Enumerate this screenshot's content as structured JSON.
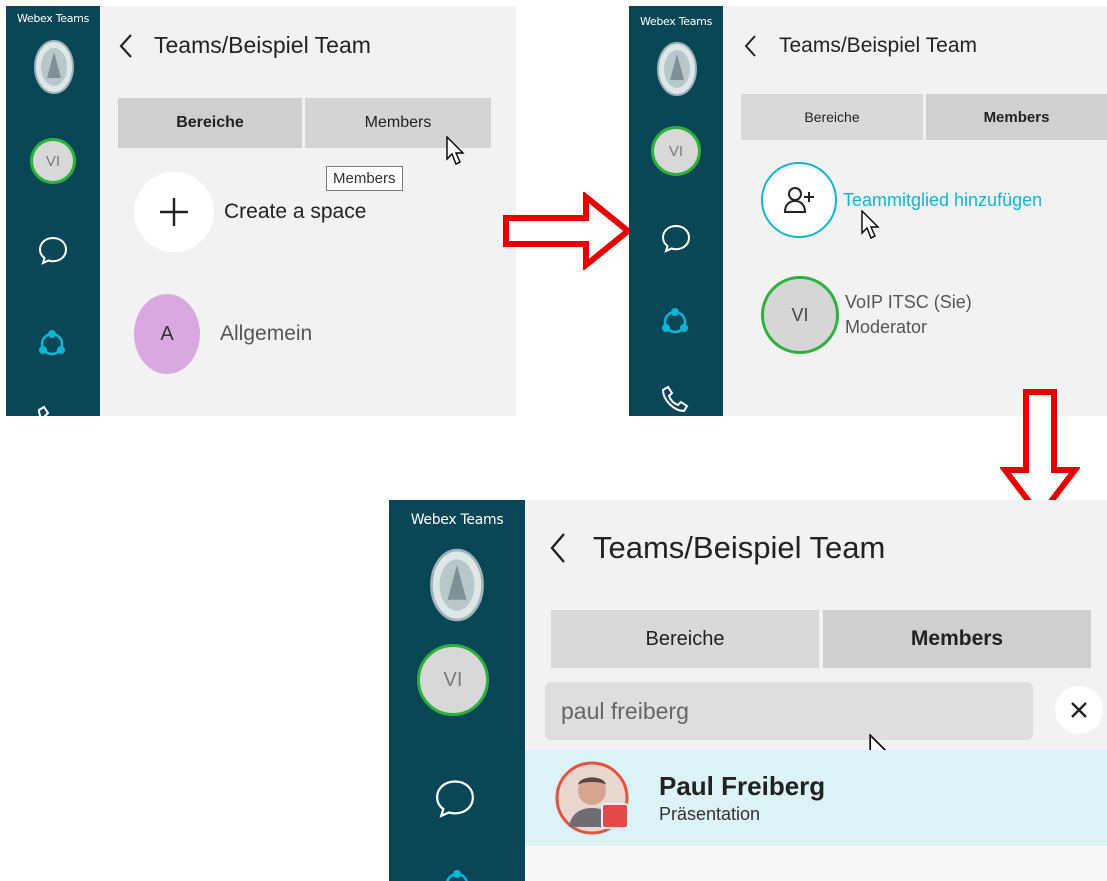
{
  "app_title": "Webex Teams",
  "header_title": "Teams/Beispiel Team",
  "tabs": {
    "spaces": "Bereiche",
    "members": "Members"
  },
  "tooltip": "Members",
  "user_avatar_initials": "VI",
  "panel1": {
    "create_space": "Create a space",
    "space_initial": "A",
    "space_name": "Allgemein"
  },
  "panel2": {
    "add_member": "Teammitglied hinzufügen",
    "member_initials": "VI",
    "member_name": "VoIP ITSC (Sie)",
    "member_role": "Moderator"
  },
  "panel3": {
    "search_value": "paul freiberg",
    "result_name": "Paul Freiberg",
    "result_status": "Präsentation"
  },
  "colors": {
    "sidebar": "#0a4756",
    "accent": "#0fb5d8",
    "presence_green": "#2cb23c",
    "space_avatar": "#d9a8e0",
    "selected_row": "#dcf2f7",
    "arrow": "#e60000"
  }
}
